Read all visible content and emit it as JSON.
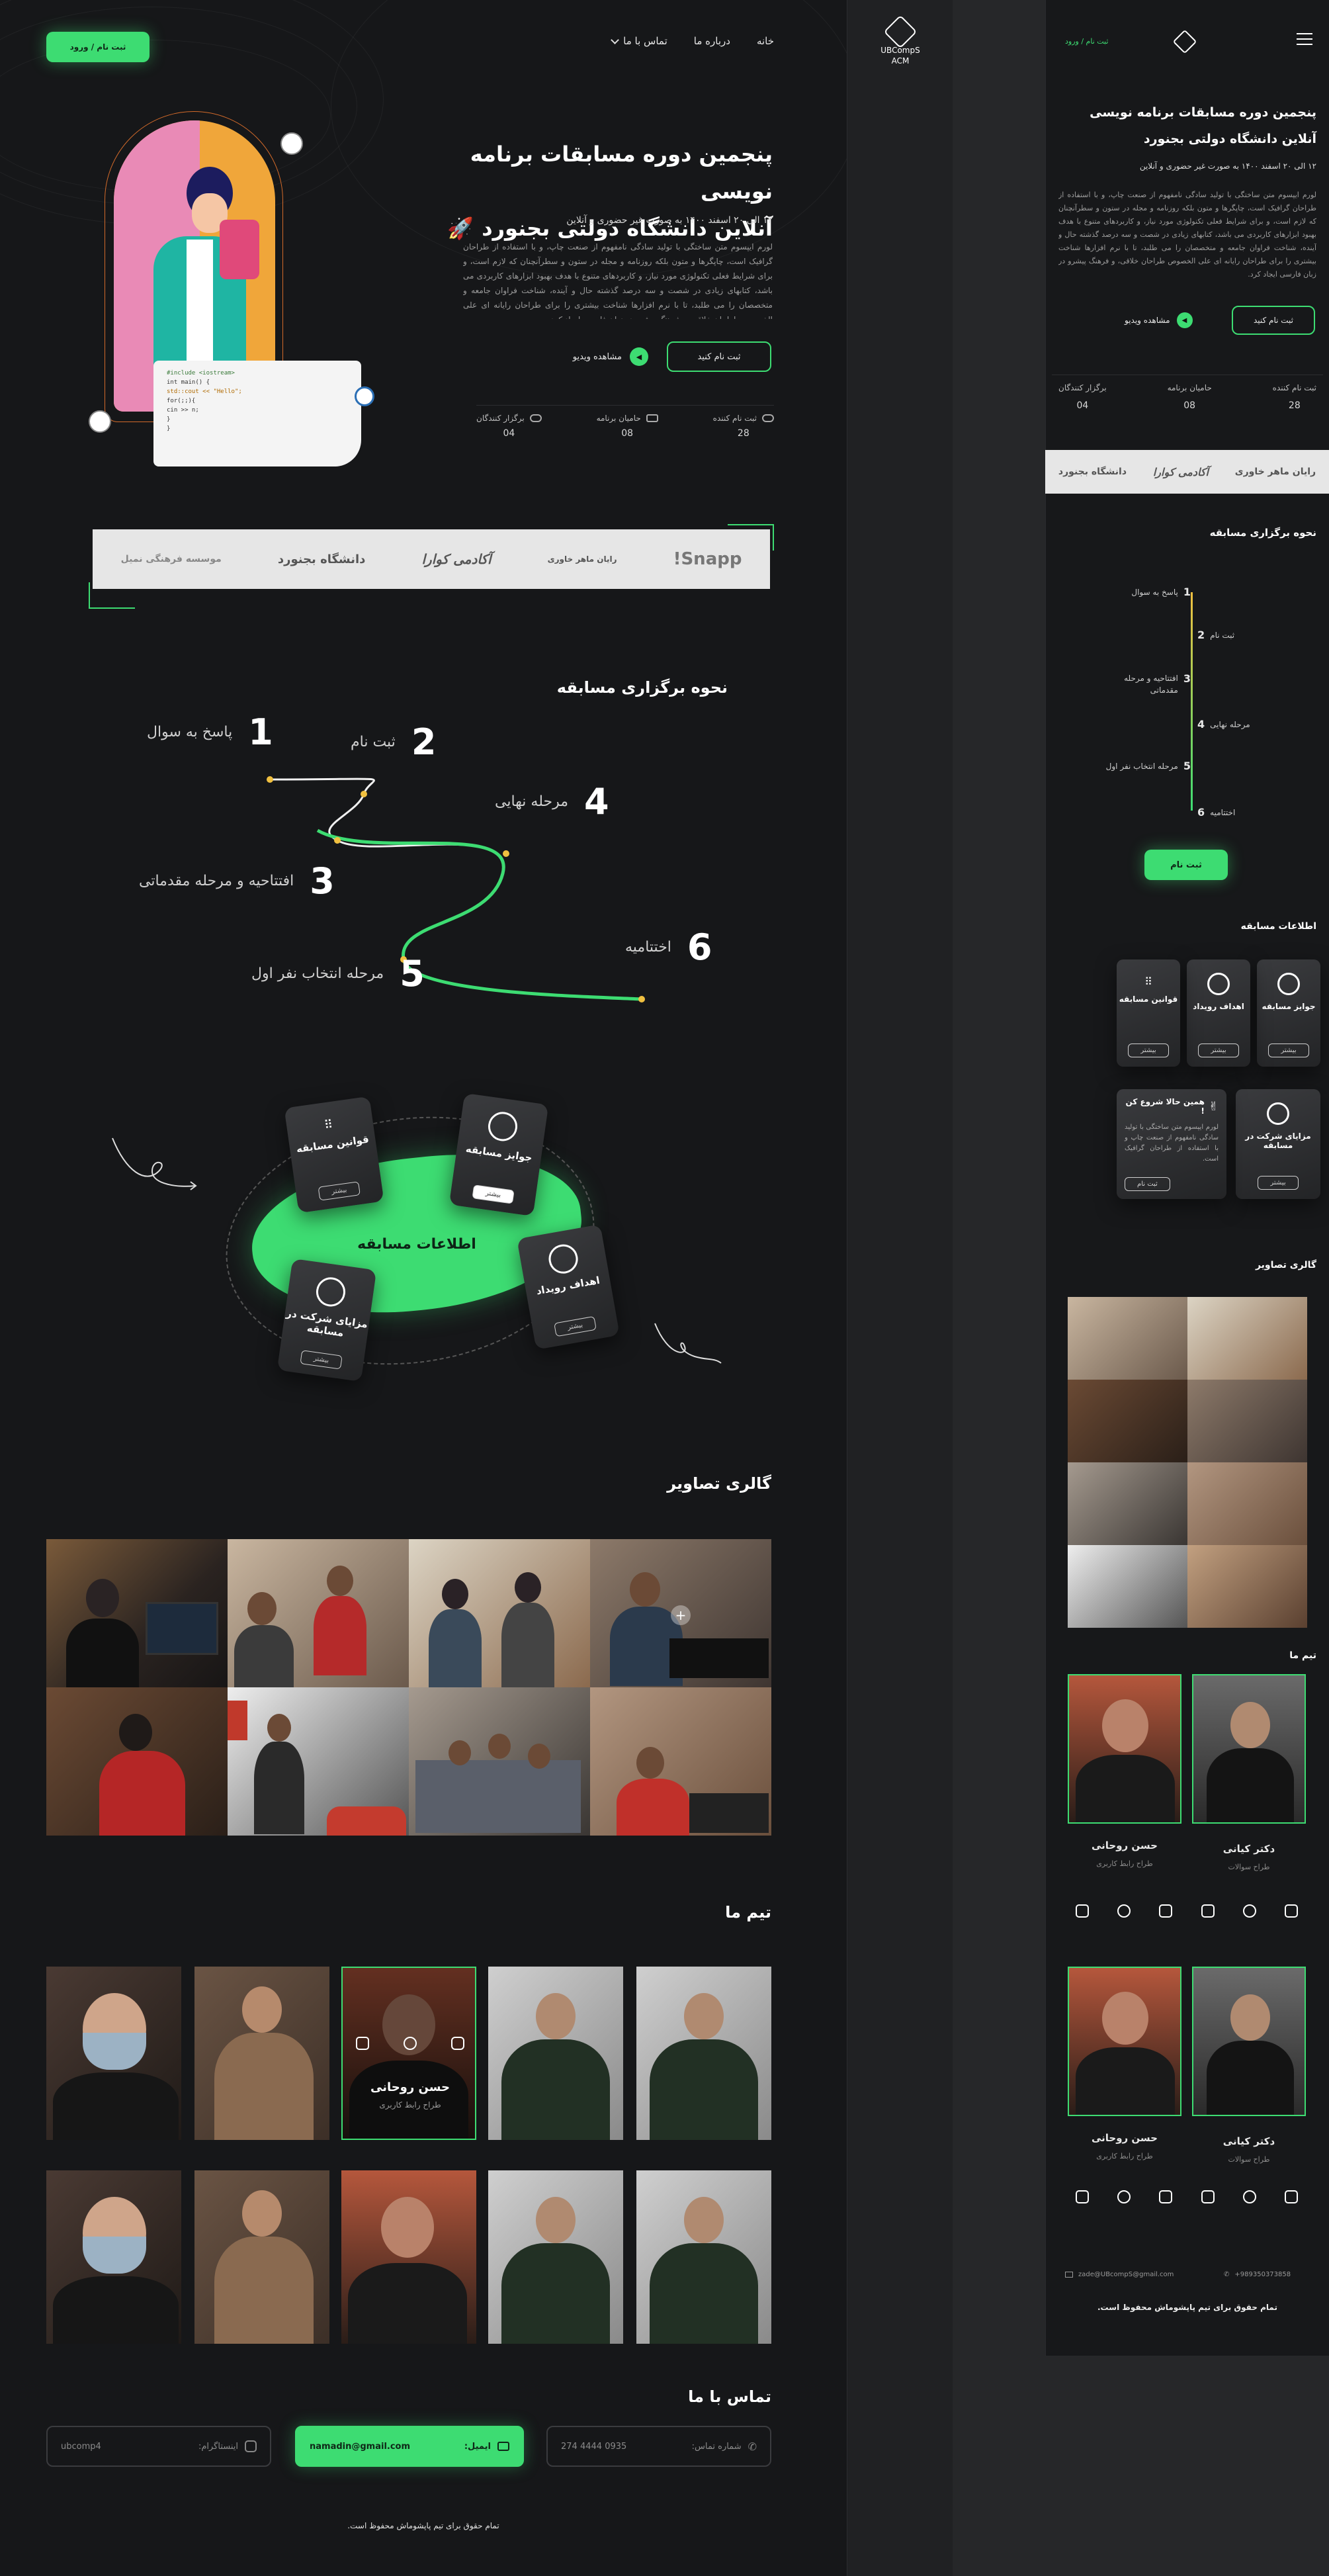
{
  "nav": {
    "login_btn": "ثبت نام / ورود",
    "home": "خانه",
    "about": "درباره ما",
    "contact": "تماس با ما",
    "brand_name": "UBCompS\nACM"
  },
  "hero": {
    "title_line1": "پنجمین دوره مسابقات برنامه نویسی",
    "title_line2": "آنلاین دانشگاه دولتی بجنورد",
    "rocket": "🚀",
    "subtitle": "۱۲ الی ۲۰ اسفند ۱۴۰۰ به صورت غیر حضوری و آنلاین",
    "paragraph": "لورم ایپسوم متن ساختگی با تولید سادگی نامفهوم از صنعت چاپ، و با استفاده از طراحان گرافیک است، چاپگرها و متون بلکه روزنامه و مجله در ستون و سطرآنچنان که لازم است، و برای شرایط فعلی تکنولوژی مورد نیاز، و کاربردهای متنوع با هدف بهبود ابزارهای کاربردی می باشد، کتابهای زیادی در شصت و سه درصد گذشته حال و آینده، شناخت فراوان جامعه و متخصصان را می طلبد، تا با نرم افزارها شناخت بیشتری را برای طراحان رایانه ای علی الخصوص طراحان خلاقی، و فرهنگ پیشرو در زبان فارسی ایجاد کرد.",
    "register_btn": "ثبت نام کنید",
    "video_btn": "مشاهده ویدیو",
    "stats": [
      {
        "label": "ثبت نام کننده",
        "value": "28"
      },
      {
        "label": "حامیان برنامه",
        "value": "08"
      },
      {
        "label": "برگزار کنندگان",
        "value": "04"
      }
    ],
    "code_lines": [
      "#include <iostream>",
      "int main() {",
      "  std::cout << \"Hello\";",
      "  for(;;){",
      "    cin >> n;",
      "  }",
      "}"
    ]
  },
  "sponsors": [
    "Snapp!",
    "رایان ماهر خاوری",
    "آکادمی کوارا",
    "دانشگاه بجنورد",
    "موسسه فرهنگی نمیل"
  ],
  "steps": {
    "title": "نحوه برگزاری مسابقه",
    "items": [
      {
        "num": "1",
        "label": "پاسخ به سوال"
      },
      {
        "num": "2",
        "label": "ثبت نام"
      },
      {
        "num": "3",
        "label": "افتتاحیه و مرحله مقدماتی"
      },
      {
        "num": "4",
        "label": "مرحله نهایی"
      },
      {
        "num": "5",
        "label": "مرحله انتخاب نفر اول"
      },
      {
        "num": "6",
        "label": "اختتامیه"
      }
    ],
    "mobile_register_btn": "ثبت نام"
  },
  "info": {
    "title": "اطلاعات مسابقه",
    "cards": [
      {
        "label": "قوانین مسابقه",
        "btn": "بیشتر"
      },
      {
        "label": "جوایز مسابقه",
        "btn": "بیشتر"
      },
      {
        "label": "اهداف رویداد",
        "btn": "بیشتر"
      },
      {
        "label": "مزایای شرکت در مسابقه",
        "btn": "بیشتر"
      }
    ],
    "start_card": {
      "title": "همین حالا شروع کن !",
      "text": "لورم ایپسوم متن ساختگی با تولید سادگی نامفهوم از صنعت چاپ و با استفاده از طراحان گرافیک است.",
      "btn": "ثبت نام"
    }
  },
  "gallery": {
    "title": "گالری تصاویر"
  },
  "team": {
    "title": "تیم ما",
    "members": [
      {
        "name": "حسن روحانی",
        "role": "طراح رابط کاربری"
      },
      {
        "name": "دکتر کیانی",
        "role": "طراح سوالات"
      }
    ]
  },
  "contact": {
    "title": "تماس با ما",
    "phone_label": "شماره تماس:",
    "phone_value": "0935 4444 274",
    "email_label": "ایمیل:",
    "email_value": "namadin@gmail.com",
    "instagram_label": "اینستاگرام:",
    "instagram_value": "ubcomp4",
    "mobile_email": "zade@UBcompS@gmail.com",
    "mobile_phone": "+989350373858"
  },
  "footer": {
    "copyright": "تمام حقوق برای تیم پاپشوماش محفوظ است."
  },
  "colors": {
    "accent": "#3ddc72",
    "bg": "#161719",
    "panel": "#262729"
  }
}
